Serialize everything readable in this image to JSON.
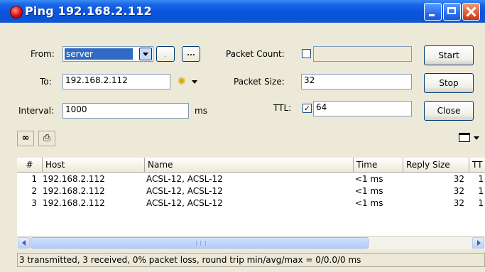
{
  "window": {
    "title": "Ping 192.168.2.112"
  },
  "form": {
    "from_label": "From:",
    "from_value": "server",
    "to_label": "To:",
    "to_value": "192.168.2.112",
    "interval_label": "Interval:",
    "interval_value": "1000",
    "interval_unit": "ms",
    "packet_count_label": "Packet Count:",
    "packet_count_value": "",
    "packet_count_checked": false,
    "packet_size_label": "Packet Size:",
    "packet_size_value": "32",
    "ttl_label": "TTL:",
    "ttl_value": "64",
    "ttl_checked": true,
    "ellipsis_button": "...",
    "small_button": "."
  },
  "buttons": {
    "start": "Start",
    "stop": "Stop",
    "close": "Close"
  },
  "table": {
    "columns": [
      "#",
      "Host",
      "Name",
      "Time",
      "Reply Size",
      "TT"
    ],
    "rows": [
      {
        "num": "1",
        "host": "192.168.2.112",
        "name": "ACSL-12, ACSL-12",
        "time": "<1 ms",
        "reply_size": "32",
        "ttl": "1"
      },
      {
        "num": "2",
        "host": "192.168.2.112",
        "name": "ACSL-12, ACSL-12",
        "time": "<1 ms",
        "reply_size": "32",
        "ttl": "1"
      },
      {
        "num": "3",
        "host": "192.168.2.112",
        "name": "ACSL-12, ACSL-12",
        "time": "<1 ms",
        "reply_size": "32",
        "ttl": "1"
      }
    ]
  },
  "status": {
    "text": "3 transmitted, 3 received, 0% packet loss, round trip min/avg/max = 0/0.0/0 ms"
  },
  "icons": {
    "title": "red-dot-icon",
    "find": "binoculars-icon",
    "print": "printer-icon",
    "columns": "columns-icon",
    "to_dropdown": "yellow-gear-icon"
  }
}
